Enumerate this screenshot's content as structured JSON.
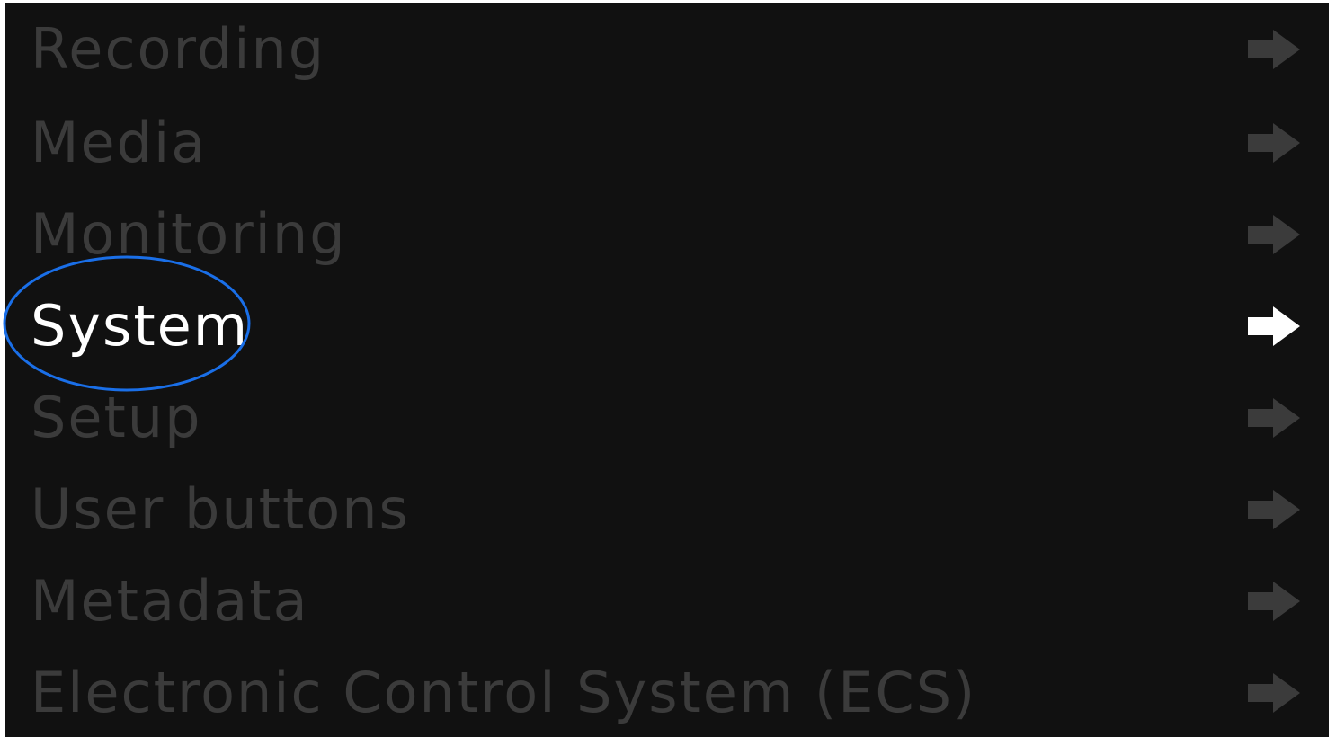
{
  "menu": {
    "items": [
      {
        "label": "Recording",
        "icon": "arrow-right-icon"
      },
      {
        "label": "Media",
        "icon": "arrow-right-icon"
      },
      {
        "label": "Monitoring",
        "icon": "arrow-right-icon"
      },
      {
        "label": "System",
        "icon": "arrow-right-icon",
        "selected": true
      },
      {
        "label": "Setup",
        "icon": "arrow-right-icon"
      },
      {
        "label": "User buttons",
        "icon": "arrow-right-icon"
      },
      {
        "label": "Metadata",
        "icon": "arrow-right-icon"
      },
      {
        "label": "Electronic Control System (ECS)",
        "icon": "arrow-right-icon"
      }
    ]
  },
  "colors": {
    "background": "#111111",
    "inactive_text": "#3b3b3b",
    "selected_text": "#ffffff",
    "annotation_ring": "#1a6fe8"
  }
}
